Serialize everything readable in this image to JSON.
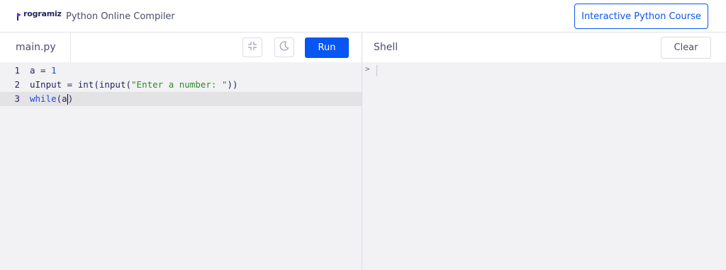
{
  "header": {
    "logo_text": "rogramiz",
    "title": "Python Online Compiler",
    "course_button": "Interactive Python Course"
  },
  "editor": {
    "file_tab": "main.py",
    "run_label": "Run",
    "lines": [
      {
        "number": "1",
        "a": "a",
        "eq": " = ",
        "val": "1"
      },
      {
        "number": "2",
        "var": "uInput",
        "eq": " = ",
        "f1": "int",
        "p1": "(",
        "f2": "input",
        "p2": "(",
        "str": "\"Enter a number: \"",
        "close": "))"
      },
      {
        "number": "3",
        "kw": "while",
        "rest": "(a",
        "close": ")"
      }
    ],
    "active_line": 3
  },
  "shell": {
    "title": "Shell",
    "clear_label": "Clear",
    "prompt": ">"
  },
  "colors": {
    "accent": "#0556f3",
    "text": "#25265e",
    "panel_bg": "#f2f2f4"
  },
  "icons": [
    "logo-icon",
    "minimize-icon",
    "moon-icon"
  ]
}
